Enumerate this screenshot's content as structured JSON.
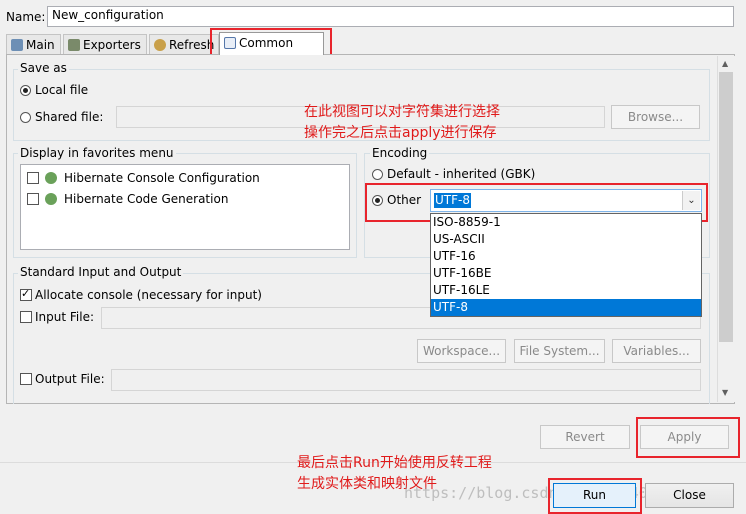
{
  "name": {
    "label": "Name:",
    "value": "New_configuration"
  },
  "tabs": [
    {
      "label": "Main",
      "icon": "main-tab-icon"
    },
    {
      "label": "Exporters",
      "icon": "exporters-tab-icon"
    },
    {
      "label": "Refresh",
      "icon": "refresh-tab-icon"
    },
    {
      "label": "Common",
      "icon": "common-tab-icon",
      "active": true
    }
  ],
  "save_as": {
    "title": "Save as",
    "local_file": "Local file",
    "shared_file": "Shared file:",
    "browse": "Browse..."
  },
  "favorites": {
    "title": "Display in favorites menu",
    "items": [
      "Hibernate Console Configuration",
      "Hibernate Code Generation"
    ]
  },
  "encoding": {
    "title": "Encoding",
    "default": "Default - inherited (GBK)",
    "other": "Other",
    "selected": "UTF-8",
    "options": [
      "ISO-8859-1",
      "US-ASCII",
      "UTF-16",
      "UTF-16BE",
      "UTF-16LE",
      "UTF-8"
    ]
  },
  "std_io": {
    "title": "Standard Input and Output",
    "allocate_console": "Allocate console (necessary for input)",
    "input_file": "Input File:",
    "workspace": "Workspace...",
    "file_system": "File System...",
    "variables": "Variables...",
    "output_file": "Output File:"
  },
  "buttons": {
    "revert": "Revert",
    "apply": "Apply",
    "run": "Run",
    "close": "Close"
  },
  "annotations": {
    "encoding_note_1": "在此视图可以对字符集进行选择",
    "encoding_note_2": "操作完之后点击apply进行保存",
    "run_note_1": "最后点击Run开始使用反转工程",
    "run_note_2": "生成实体类和映射文件"
  },
  "watermark": "https://blog.csdn.net/qq_40889716",
  "colors": {
    "annotation": "#e01a1a",
    "selection": "#0078d7"
  }
}
